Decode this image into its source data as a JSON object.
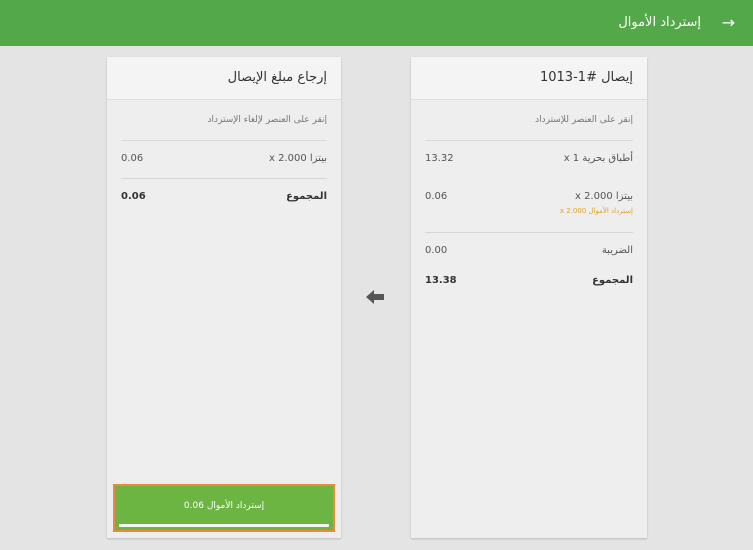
{
  "appbar": {
    "title": "إسترداد الأموال",
    "back_icon": "arrow-right-icon"
  },
  "left_card": {
    "title": "إرجاع مبلغ الإيصال",
    "hint": "إنقر على العنصر لإلغاء الإسترداد",
    "items": [
      {
        "name": "بيتزا  2.000 x",
        "amount": "0.06"
      }
    ],
    "total_label": "المجموع",
    "total_amount": "0.06",
    "refund_button_text": "إسترداد الأموال 0.06"
  },
  "right_card": {
    "title": "إيصال #1-1013",
    "hint": "إنقر على العنصر للإسترداد",
    "items": [
      {
        "name": "أطباق بحرية  1 x",
        "amount": "13.32",
        "sub": ""
      },
      {
        "name": "بيتزا  2.000 x",
        "amount": "0.06",
        "sub": "إسترداد الأموال 2.000 x"
      }
    ],
    "tax_label": "الضريبة",
    "tax_amount": "0.00",
    "total_label": "المجموع",
    "total_amount": "13.38"
  },
  "colors": {
    "accent": "#53a84a",
    "button": "#6cb543",
    "button_border": "#f0883b",
    "refund_note": "#e3a12a"
  },
  "transfer_icon": "arrow-left-icon"
}
